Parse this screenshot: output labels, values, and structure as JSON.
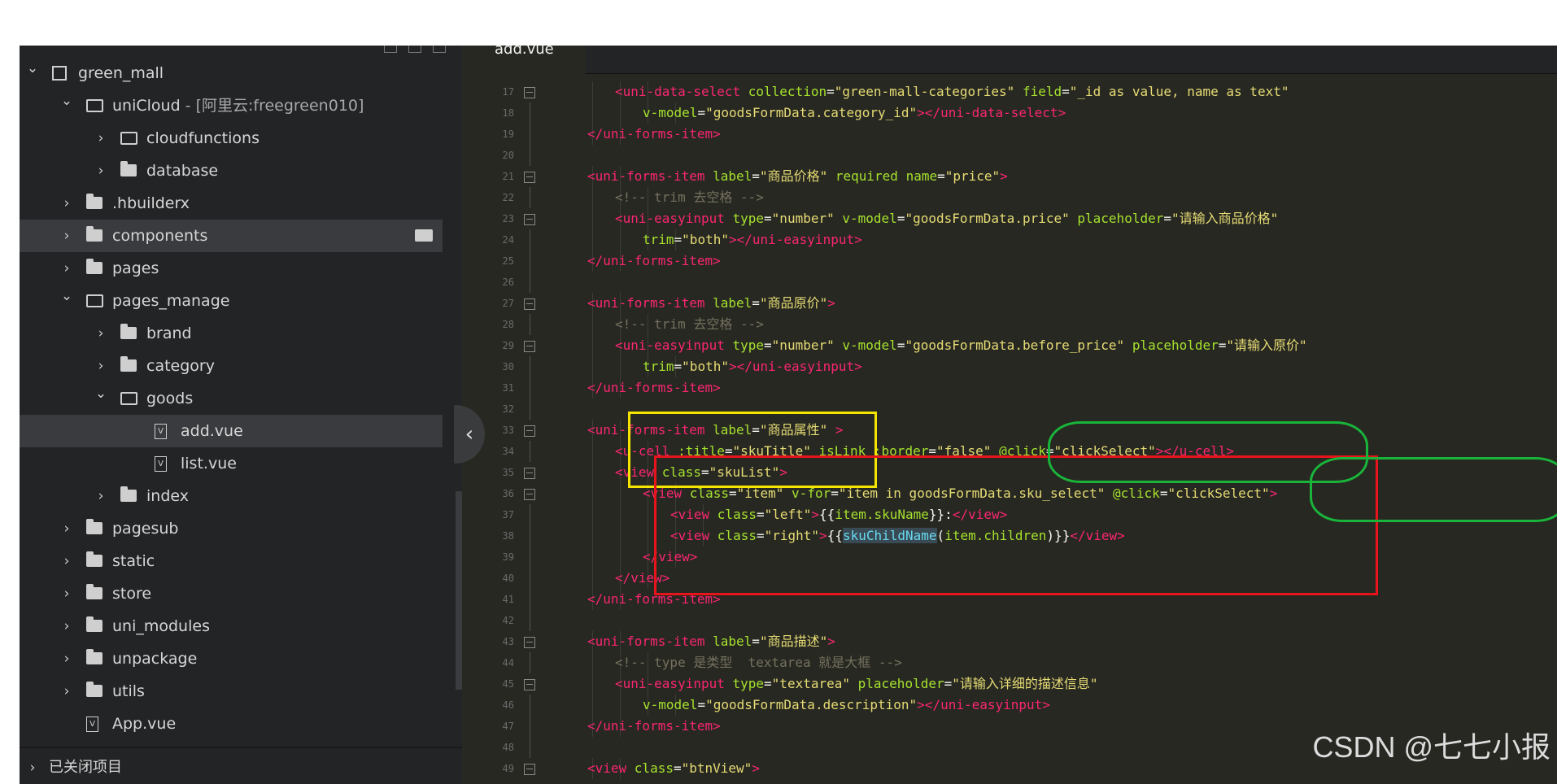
{
  "window": {
    "active_tab": "add.vue"
  },
  "sidebar": {
    "items": [
      {
        "label": "green_mall",
        "extra": "",
        "depth": 0,
        "chevron": "down",
        "icon": "project",
        "selected": false
      },
      {
        "label": "uniCloud",
        "extra": " - [阿里云:freegreen010]",
        "depth": 1,
        "chevron": "down",
        "icon": "cloud",
        "selected": false
      },
      {
        "label": "cloudfunctions",
        "extra": "",
        "depth": 2,
        "chevron": "right",
        "icon": "cloud",
        "selected": false
      },
      {
        "label": "database",
        "extra": "",
        "depth": 2,
        "chevron": "right",
        "icon": "folder",
        "selected": false
      },
      {
        "label": ".hbuilderx",
        "extra": "",
        "depth": 1,
        "chevron": "right",
        "icon": "folder",
        "selected": false
      },
      {
        "label": "components",
        "extra": "",
        "depth": 1,
        "chevron": "right",
        "icon": "folder",
        "selected": true
      },
      {
        "label": "pages",
        "extra": "",
        "depth": 1,
        "chevron": "right",
        "icon": "folder",
        "selected": false
      },
      {
        "label": "pages_manage",
        "extra": "",
        "depth": 1,
        "chevron": "down",
        "icon": "open",
        "selected": false
      },
      {
        "label": "brand",
        "extra": "",
        "depth": 2,
        "chevron": "right",
        "icon": "folder",
        "selected": false
      },
      {
        "label": "category",
        "extra": "",
        "depth": 2,
        "chevron": "right",
        "icon": "folder",
        "selected": false
      },
      {
        "label": "goods",
        "extra": "",
        "depth": 2,
        "chevron": "down",
        "icon": "open",
        "selected": false
      },
      {
        "label": "add.vue",
        "extra": "",
        "depth": 3,
        "chevron": "",
        "icon": "file",
        "selected": true
      },
      {
        "label": "list.vue",
        "extra": "",
        "depth": 3,
        "chevron": "",
        "icon": "file",
        "selected": false
      },
      {
        "label": "index",
        "extra": "",
        "depth": 2,
        "chevron": "right",
        "icon": "folder",
        "selected": false
      },
      {
        "label": "pagesub",
        "extra": "",
        "depth": 1,
        "chevron": "right",
        "icon": "folder",
        "selected": false
      },
      {
        "label": "static",
        "extra": "",
        "depth": 1,
        "chevron": "right",
        "icon": "folder",
        "selected": false
      },
      {
        "label": "store",
        "extra": "",
        "depth": 1,
        "chevron": "right",
        "icon": "folder",
        "selected": false
      },
      {
        "label": "uni_modules",
        "extra": "",
        "depth": 1,
        "chevron": "right",
        "icon": "folder",
        "selected": false
      },
      {
        "label": "unpackage",
        "extra": "",
        "depth": 1,
        "chevron": "right",
        "icon": "folder",
        "selected": false
      },
      {
        "label": "utils",
        "extra": "",
        "depth": 1,
        "chevron": "right",
        "icon": "folder",
        "selected": false
      },
      {
        "label": "App.vue",
        "extra": "",
        "depth": 1,
        "chevron": "",
        "icon": "file",
        "selected": false
      }
    ],
    "closed_projects_label": "已关闭项目"
  },
  "code": {
    "lines": [
      {
        "n": "17",
        "fold": true,
        "indent": 2,
        "parts": [
          [
            "k",
            "<uni-data-select "
          ],
          [
            "a",
            "collection"
          ],
          [
            "n",
            "="
          ],
          [
            "s",
            "\"green-mall-categories\""
          ],
          [
            "n",
            " "
          ],
          [
            "a",
            "field"
          ],
          [
            "n",
            "="
          ],
          [
            "s",
            "\"_id as value, name as text\""
          ]
        ]
      },
      {
        "n": "18",
        "fold": false,
        "indent": 3,
        "parts": [
          [
            "a",
            "v-model"
          ],
          [
            "n",
            "="
          ],
          [
            "s",
            "\"goodsFormData.category_id\""
          ],
          [
            "k",
            "></uni-data-select>"
          ]
        ]
      },
      {
        "n": "19",
        "fold": false,
        "indent": 1,
        "parts": [
          [
            "k",
            "</uni-forms-item>"
          ]
        ]
      },
      {
        "n": "20",
        "fold": false,
        "indent": 0,
        "parts": []
      },
      {
        "n": "21",
        "fold": true,
        "indent": 1,
        "parts": [
          [
            "k",
            "<uni-forms-item "
          ],
          [
            "a",
            "label"
          ],
          [
            "n",
            "="
          ],
          [
            "s",
            "\"商品价格\""
          ],
          [
            "n",
            " "
          ],
          [
            "a",
            "required"
          ],
          [
            "n",
            " "
          ],
          [
            "a",
            "name"
          ],
          [
            "n",
            "="
          ],
          [
            "s",
            "\"price\""
          ],
          [
            "k",
            ">"
          ]
        ]
      },
      {
        "n": "22",
        "fold": false,
        "indent": 2,
        "parts": [
          [
            "c",
            "<!-- trim 去空格 -->"
          ]
        ]
      },
      {
        "n": "23",
        "fold": true,
        "indent": 2,
        "parts": [
          [
            "k",
            "<uni-easyinput "
          ],
          [
            "a",
            "type"
          ],
          [
            "n",
            "="
          ],
          [
            "s",
            "\"number\""
          ],
          [
            "n",
            " "
          ],
          [
            "a",
            "v-model"
          ],
          [
            "n",
            "="
          ],
          [
            "s",
            "\"goodsFormData.price\""
          ],
          [
            "n",
            " "
          ],
          [
            "a",
            "placeholder"
          ],
          [
            "n",
            "="
          ],
          [
            "s",
            "\"请输入商品价格\""
          ]
        ]
      },
      {
        "n": "24",
        "fold": false,
        "indent": 3,
        "parts": [
          [
            "a",
            "trim"
          ],
          [
            "n",
            "="
          ],
          [
            "s",
            "\"both\""
          ],
          [
            "k",
            "></uni-easyinput>"
          ]
        ]
      },
      {
        "n": "25",
        "fold": false,
        "indent": 1,
        "parts": [
          [
            "k",
            "</uni-forms-item>"
          ]
        ]
      },
      {
        "n": "26",
        "fold": false,
        "indent": 0,
        "parts": []
      },
      {
        "n": "27",
        "fold": true,
        "indent": 1,
        "parts": [
          [
            "k",
            "<uni-forms-item "
          ],
          [
            "a",
            "label"
          ],
          [
            "n",
            "="
          ],
          [
            "s",
            "\"商品原价\""
          ],
          [
            "k",
            ">"
          ]
        ]
      },
      {
        "n": "28",
        "fold": false,
        "indent": 2,
        "parts": [
          [
            "c",
            "<!-- trim 去空格 -->"
          ]
        ]
      },
      {
        "n": "29",
        "fold": true,
        "indent": 2,
        "parts": [
          [
            "k",
            "<uni-easyinput "
          ],
          [
            "a",
            "type"
          ],
          [
            "n",
            "="
          ],
          [
            "s",
            "\"number\""
          ],
          [
            "n",
            " "
          ],
          [
            "a",
            "v-model"
          ],
          [
            "n",
            "="
          ],
          [
            "s",
            "\"goodsFormData.before_price\""
          ],
          [
            "n",
            " "
          ],
          [
            "a",
            "placeholder"
          ],
          [
            "n",
            "="
          ],
          [
            "s",
            "\"请输入原价\""
          ]
        ]
      },
      {
        "n": "30",
        "fold": false,
        "indent": 3,
        "parts": [
          [
            "a",
            "trim"
          ],
          [
            "n",
            "="
          ],
          [
            "s",
            "\"both\""
          ],
          [
            "k",
            "></uni-easyinput>"
          ]
        ]
      },
      {
        "n": "31",
        "fold": false,
        "indent": 1,
        "parts": [
          [
            "k",
            "</uni-forms-item>"
          ]
        ]
      },
      {
        "n": "32",
        "fold": false,
        "indent": 0,
        "parts": []
      },
      {
        "n": "33",
        "fold": true,
        "indent": 1,
        "parts": [
          [
            "k",
            "<uni-forms-item "
          ],
          [
            "a",
            "label"
          ],
          [
            "n",
            "="
          ],
          [
            "s",
            "\"商品属性\""
          ],
          [
            "n",
            " "
          ],
          [
            "k",
            ">"
          ]
        ]
      },
      {
        "n": "34",
        "fold": false,
        "indent": 2,
        "parts": [
          [
            "k",
            "<u-cell "
          ],
          [
            "a",
            ":title"
          ],
          [
            "n",
            "="
          ],
          [
            "s",
            "\"skuTitle\""
          ],
          [
            "n",
            " "
          ],
          [
            "a",
            "isLink"
          ],
          [
            "n",
            " "
          ],
          [
            "a",
            ":border"
          ],
          [
            "n",
            "="
          ],
          [
            "s",
            "\"false\""
          ],
          [
            "n",
            " "
          ],
          [
            "a",
            "@click"
          ],
          [
            "n",
            "="
          ],
          [
            "s",
            "\"clickSelect\""
          ],
          [
            "k",
            "></u-cell>"
          ]
        ]
      },
      {
        "n": "35",
        "fold": true,
        "indent": 2,
        "parts": [
          [
            "k",
            "<view "
          ],
          [
            "a",
            "class"
          ],
          [
            "n",
            "="
          ],
          [
            "s",
            "\"skuList\""
          ],
          [
            "k",
            ">"
          ]
        ]
      },
      {
        "n": "36",
        "fold": true,
        "indent": 3,
        "parts": [
          [
            "k",
            "<view "
          ],
          [
            "a",
            "class"
          ],
          [
            "n",
            "="
          ],
          [
            "s",
            "\"item\""
          ],
          [
            "n",
            " "
          ],
          [
            "a",
            "v-for"
          ],
          [
            "n",
            "="
          ],
          [
            "s",
            "\"item in goodsFormData.sku_select\""
          ],
          [
            "n",
            " "
          ],
          [
            "a",
            "@click"
          ],
          [
            "n",
            "="
          ],
          [
            "s",
            "\"clickSelect\""
          ],
          [
            "k",
            ">"
          ]
        ]
      },
      {
        "n": "37",
        "fold": false,
        "indent": 4,
        "parts": [
          [
            "k",
            "<view "
          ],
          [
            "a",
            "class"
          ],
          [
            "n",
            "="
          ],
          [
            "s",
            "\"left\""
          ],
          [
            "k",
            ">"
          ],
          [
            "n",
            "{{"
          ],
          [
            "a",
            "item.skuName"
          ],
          [
            "n",
            "}}:"
          ],
          [
            "k",
            "</view>"
          ]
        ]
      },
      {
        "n": "38",
        "fold": false,
        "indent": 4,
        "parts": [
          [
            "k",
            "<view "
          ],
          [
            "a",
            "class"
          ],
          [
            "n",
            "="
          ],
          [
            "s",
            "\"right\""
          ],
          [
            "k",
            ">"
          ],
          [
            "n",
            "{{"
          ],
          [
            "fn",
            "skuChildName"
          ],
          [
            "n",
            "("
          ],
          [
            "a",
            "item.children"
          ],
          [
            "n",
            ")}}"
          ],
          [
            "k",
            "</view>"
          ]
        ]
      },
      {
        "n": "39",
        "fold": false,
        "indent": 3,
        "parts": [
          [
            "k",
            "</view>"
          ]
        ]
      },
      {
        "n": "40",
        "fold": false,
        "indent": 2,
        "parts": [
          [
            "k",
            "</view>"
          ]
        ]
      },
      {
        "n": "41",
        "fold": false,
        "indent": 1,
        "parts": [
          [
            "k",
            "</uni-forms-item>"
          ]
        ]
      },
      {
        "n": "42",
        "fold": false,
        "indent": 0,
        "parts": []
      },
      {
        "n": "43",
        "fold": true,
        "indent": 1,
        "parts": [
          [
            "k",
            "<uni-forms-item "
          ],
          [
            "a",
            "label"
          ],
          [
            "n",
            "="
          ],
          [
            "s",
            "\"商品描述\""
          ],
          [
            "k",
            ">"
          ]
        ]
      },
      {
        "n": "44",
        "fold": false,
        "indent": 2,
        "parts": [
          [
            "c",
            "<!-- type 是类型  textarea 就是大框 -->"
          ]
        ]
      },
      {
        "n": "45",
        "fold": true,
        "indent": 2,
        "parts": [
          [
            "k",
            "<uni-easyinput "
          ],
          [
            "a",
            "type"
          ],
          [
            "n",
            "="
          ],
          [
            "s",
            "\"textarea\""
          ],
          [
            "n",
            " "
          ],
          [
            "a",
            "placeholder"
          ],
          [
            "n",
            "="
          ],
          [
            "s",
            "\"请输入详细的描述信息\""
          ]
        ]
      },
      {
        "n": "46",
        "fold": false,
        "indent": 3,
        "parts": [
          [
            "a",
            "v-model"
          ],
          [
            "n",
            "="
          ],
          [
            "s",
            "\"goodsFormData.description\""
          ],
          [
            "k",
            "></uni-easyinput>"
          ]
        ]
      },
      {
        "n": "47",
        "fold": false,
        "indent": 1,
        "parts": [
          [
            "k",
            "</uni-forms-item>"
          ]
        ]
      },
      {
        "n": "48",
        "fold": false,
        "indent": 0,
        "parts": []
      },
      {
        "n": "49",
        "fold": true,
        "indent": 1,
        "parts": [
          [
            "k",
            "<view "
          ],
          [
            "a",
            "class"
          ],
          [
            "n",
            "="
          ],
          [
            "s",
            "\"btnView\""
          ],
          [
            "k",
            ">"
          ]
        ]
      }
    ]
  },
  "watermark": "CSDN @七七小报"
}
